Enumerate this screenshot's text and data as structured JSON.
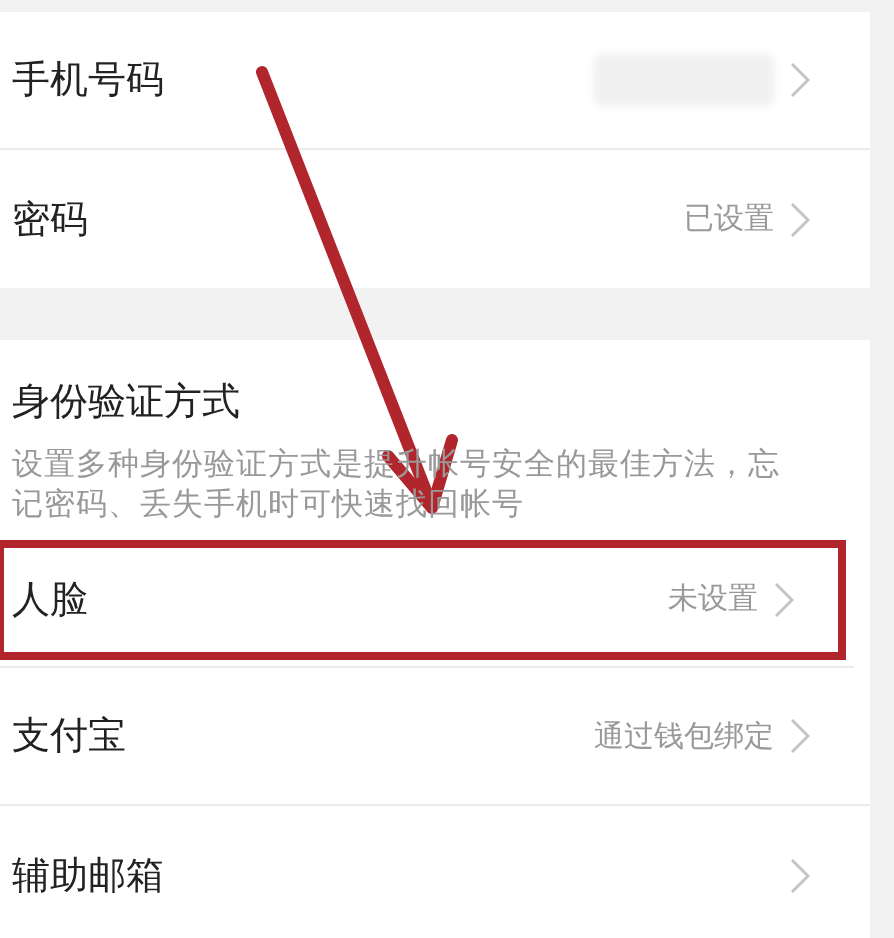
{
  "groups": [
    {
      "rows": [
        {
          "label": "手机号码",
          "value_redacted": true,
          "highlighted": false
        },
        {
          "label": "密码",
          "value": "已设置",
          "highlighted": false
        }
      ]
    },
    {
      "title": "身份验证方式",
      "description": "设置多种身份验证方式是提升帐号安全的最佳方法，忘记密码、丢失手机时可快速找回帐号",
      "rows": [
        {
          "label": "人脸",
          "value": "未设置",
          "highlighted": true
        },
        {
          "label": "支付宝",
          "value": "通过钱包绑定",
          "highlighted": false
        },
        {
          "label": "辅助邮箱",
          "highlighted": false
        }
      ]
    }
  ]
}
